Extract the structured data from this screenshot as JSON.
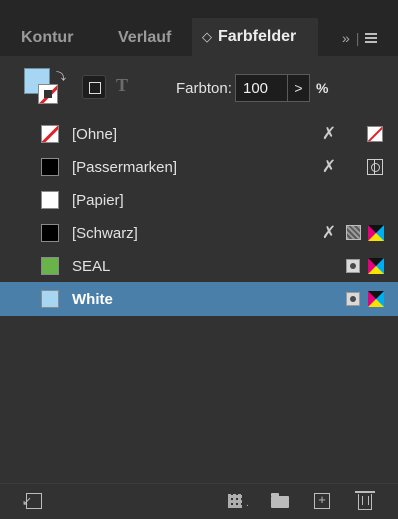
{
  "tabs": [
    {
      "label": "Kontur"
    },
    {
      "label": "Verlauf"
    },
    {
      "label": "Farbfelder",
      "updown": "◇"
    },
    {
      "label": "»",
      "sep": "|"
    }
  ],
  "toolbar": {
    "text_glyph": "T",
    "farbton_label": "Farbton:",
    "farbton_value": "100",
    "arrow": ">",
    "percent": "%"
  },
  "swatches": [
    {
      "name": "[Ohne]",
      "color": "none"
    },
    {
      "name": "[Passermarken]",
      "color": "#000000"
    },
    {
      "name": "[Papier]",
      "color": "#ffffff"
    },
    {
      "name": "[Schwarz]",
      "color": "#000000"
    },
    {
      "name": "SEAL",
      "color": "#6ab34a"
    },
    {
      "name": "White",
      "color": "#a6d6f2"
    }
  ],
  "bottombar": {
    "grid_dot": "."
  }
}
